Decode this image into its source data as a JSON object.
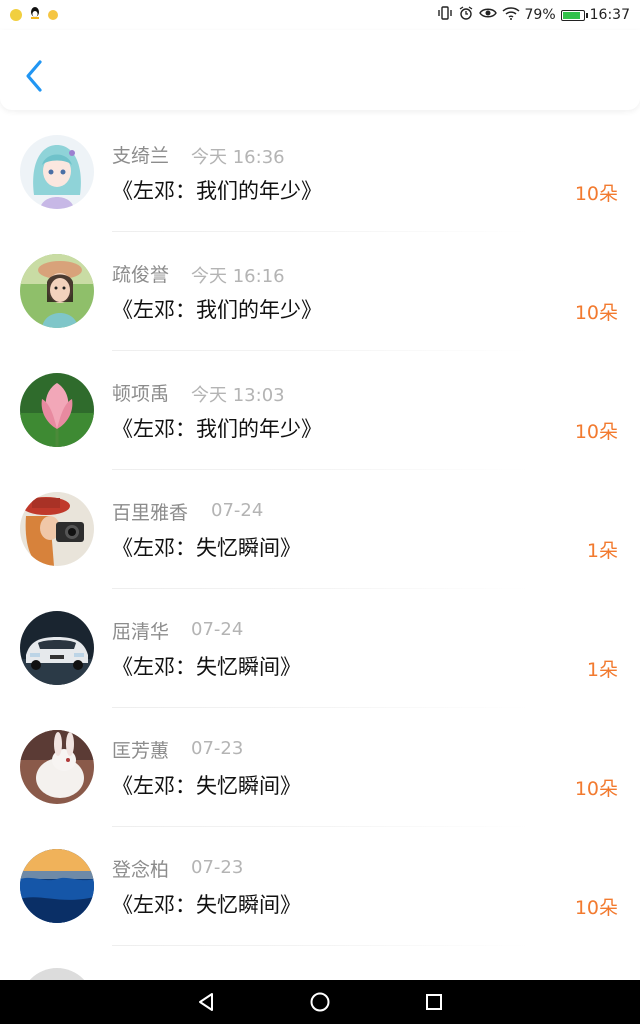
{
  "status_bar": {
    "battery_percent": "79%",
    "time": "16:37",
    "colors": {
      "battery_fill": "#31c04a"
    }
  },
  "header": {
    "back_icon": "chevron-left-icon",
    "accent": "#2196f3"
  },
  "list": {
    "count_color": "#f27a2f",
    "items": [
      {
        "name": "支绮兰",
        "time": "今天 16:36",
        "title": "《左邓：我们的年少》",
        "count": "10朵",
        "avatar": "anime-girl"
      },
      {
        "name": "疏俊誉",
        "time": "今天 16:16",
        "title": "《左邓：我们的年少》",
        "count": "10朵",
        "avatar": "child"
      },
      {
        "name": "顿项禹",
        "time": "今天 13:03",
        "title": "《左邓：我们的年少》",
        "count": "10朵",
        "avatar": "lotus"
      },
      {
        "name": "百里雅香",
        "time": "07-24",
        "title": "《左邓：失忆瞬间》",
        "count": "1朵",
        "avatar": "photographer"
      },
      {
        "name": "屈清华",
        "time": "07-24",
        "title": "《左邓：失忆瞬间》",
        "count": "1朵",
        "avatar": "car"
      },
      {
        "name": "匡芳蕙",
        "time": "07-23",
        "title": "《左邓：失忆瞬间》",
        "count": "10朵",
        "avatar": "rabbit"
      },
      {
        "name": "登念柏",
        "time": "07-23",
        "title": "《左邓：失忆瞬间》",
        "count": "10朵",
        "avatar": "ocean"
      }
    ]
  }
}
